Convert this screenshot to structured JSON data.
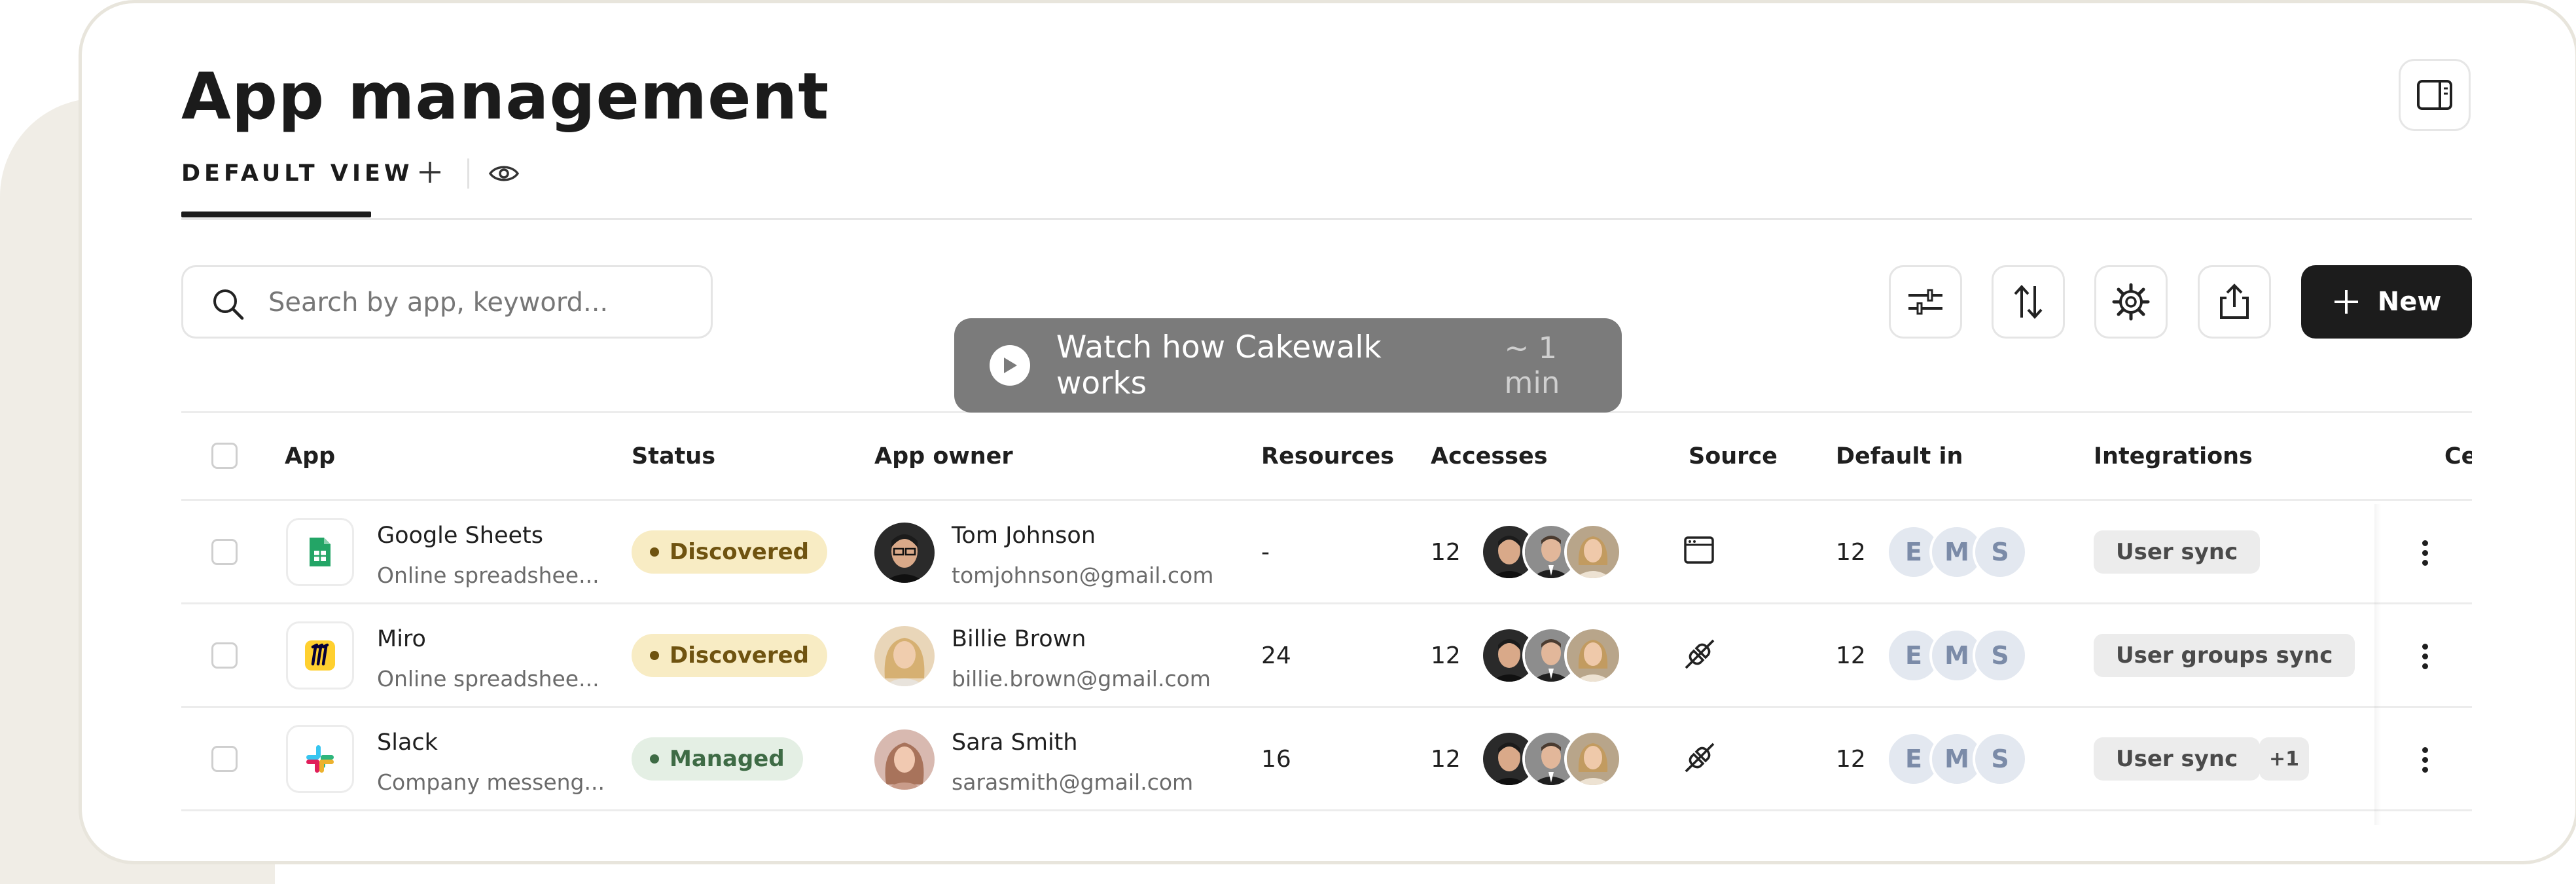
{
  "page": {
    "title": "App management"
  },
  "tabs": {
    "default_view": "DEFAULT VIEW"
  },
  "search": {
    "placeholder": "Search by app, keyword..."
  },
  "toolbar": {
    "new_label": "New"
  },
  "video": {
    "label": "Watch how Cakewalk works",
    "duration": "~ 1 min"
  },
  "table": {
    "headers": {
      "app": "App",
      "status": "Status",
      "owner": "App owner",
      "resources": "Resources",
      "accesses": "Accesses",
      "source": "Source",
      "default_in": "Default in",
      "integrations": "Integrations",
      "cut": "Ce"
    },
    "rows": [
      {
        "app_name": "Google Sheets",
        "app_desc": "Online spreadshee...",
        "status": "Discovered",
        "owner_name": "Tom Johnson",
        "owner_email": "tomjohnson@gmail.com",
        "resources": "-",
        "accesses": "12",
        "default_in": "12",
        "initials": [
          "E",
          "M",
          "S"
        ],
        "integration": "User sync"
      },
      {
        "app_name": "Miro",
        "app_desc": "Online spreadshee...",
        "status": "Discovered",
        "owner_name": "Billie Brown",
        "owner_email": "billie.brown@gmail.com",
        "resources": "24",
        "accesses": "12",
        "default_in": "12",
        "initials": [
          "E",
          "M",
          "S"
        ],
        "integration": "User groups sync"
      },
      {
        "app_name": "Slack",
        "app_desc": "Company messeng...",
        "status": "Managed",
        "owner_name": "Sara Smith",
        "owner_email": "sarasmith@gmail.com",
        "resources": "16",
        "accesses": "12",
        "default_in": "12",
        "initials": [
          "E",
          "M",
          "S"
        ],
        "integration": "User sync",
        "extra": "+1"
      }
    ]
  },
  "colors": {
    "discovered_bg": "#f8ecc4",
    "discovered_text": "#6f5310",
    "managed_bg": "#e4efe4",
    "managed_text": "#3e6b45",
    "primary_dark": "#1c1c1c"
  }
}
